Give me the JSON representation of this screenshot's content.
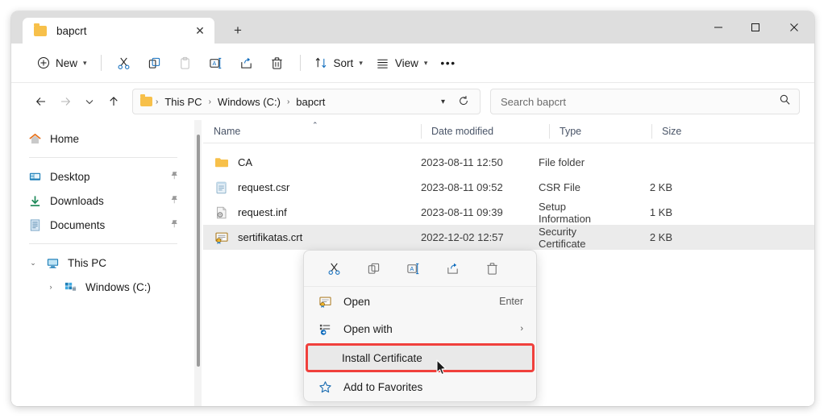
{
  "window": {
    "controls": {
      "minimize": "─",
      "maximize": "□",
      "close": "✕"
    }
  },
  "tabs": {
    "active": {
      "title": "bapcrt",
      "icon": "folder-icon",
      "close": "✕"
    },
    "new_tab": "+"
  },
  "toolbar": {
    "new_label": "New",
    "sort_label": "Sort",
    "view_label": "View",
    "overflow": "•••",
    "icons": [
      "cut-icon",
      "copy-icon",
      "paste-icon",
      "rename-icon",
      "share-icon",
      "delete-icon"
    ]
  },
  "address": {
    "back": "←",
    "forward": "→",
    "recent": "⌵",
    "up": "↑",
    "crumbs": [
      "This PC",
      "Windows (C:)",
      "bapcrt"
    ],
    "separator": "›",
    "dropdown": "⌵",
    "refresh": "↻"
  },
  "search": {
    "placeholder": "Search bapcrt",
    "value": "",
    "icon": "search-icon"
  },
  "sidebar": {
    "items": [
      {
        "label": "Home",
        "icon": "home-icon",
        "pinned": false,
        "indent": false,
        "expander": ""
      },
      {
        "label": "Desktop",
        "icon": "desktop-icon",
        "pinned": true,
        "indent": false,
        "expander": ""
      },
      {
        "label": "Downloads",
        "icon": "downloads-icon",
        "pinned": true,
        "indent": false,
        "expander": ""
      },
      {
        "label": "Documents",
        "icon": "documents-icon",
        "pinned": true,
        "indent": false,
        "expander": ""
      },
      {
        "label": "This PC",
        "icon": "this-pc-icon",
        "pinned": false,
        "indent": false,
        "expander": "⌄"
      },
      {
        "label": "Windows (C:)",
        "icon": "drive-icon",
        "pinned": false,
        "indent": true,
        "expander": "›"
      }
    ],
    "pin_glyph": "📌"
  },
  "filelist": {
    "columns": [
      "Name",
      "Date modified",
      "Type",
      "Size"
    ],
    "sort_caret": "⌃",
    "rows": [
      {
        "name": "CA",
        "date": "2023-08-11 12:50",
        "type": "File folder",
        "size": "",
        "icon": "folder-icon",
        "selected": false
      },
      {
        "name": "request.csr",
        "date": "2023-08-11 09:52",
        "type": "CSR File",
        "size": "2 KB",
        "icon": "csr-file-icon",
        "selected": false
      },
      {
        "name": "request.inf",
        "date": "2023-08-11 09:39",
        "type": "Setup Information",
        "size": "1 KB",
        "icon": "inf-file-icon",
        "selected": false
      },
      {
        "name": "sertifikatas.crt",
        "date": "2022-12-02 12:57",
        "type": "Security Certificate",
        "size": "2 KB",
        "icon": "certificate-icon",
        "selected": true
      }
    ]
  },
  "context_menu": {
    "toolbar_icons": [
      "cut-icon",
      "copy-icon",
      "rename-icon",
      "share-icon",
      "delete-icon"
    ],
    "items": [
      {
        "label": "Open",
        "shortcut": "Enter",
        "icon": "certificate-icon",
        "submenu": false,
        "highlighted": false
      },
      {
        "label": "Open with",
        "shortcut": "",
        "icon": "open-with-icon",
        "submenu": true,
        "highlighted": false
      },
      {
        "label": "Install Certificate",
        "shortcut": "",
        "icon": "",
        "submenu": false,
        "highlighted": true
      },
      {
        "label": "Add to Favorites",
        "shortcut": "",
        "icon": "star-icon",
        "submenu": false,
        "highlighted": false
      }
    ],
    "submenu_arrow": "›"
  },
  "colors": {
    "highlight_border": "#f0403c",
    "folder": "#f7c04a",
    "accent": "#0f6cbd",
    "titlebar": "#dedede",
    "selection": "#ebebeb"
  }
}
